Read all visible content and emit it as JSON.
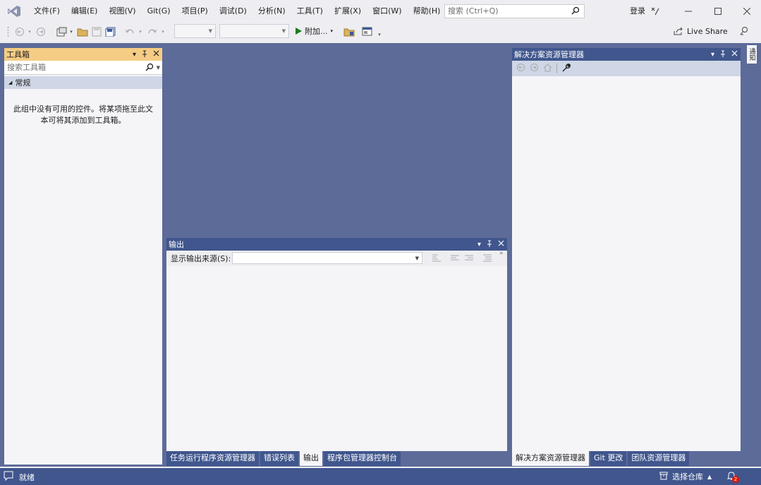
{
  "menu": [
    "文件(F)",
    "编辑(E)",
    "视图(V)",
    "Git(G)",
    "项目(P)",
    "调试(D)",
    "分析(N)",
    "工具(T)",
    "扩展(X)",
    "窗口(W)",
    "帮助(H)"
  ],
  "search": {
    "placeholder": "搜索 (Ctrl+Q)"
  },
  "signin": "登录",
  "toolbar": {
    "attach_label": "附加...",
    "live_share": "Live Share"
  },
  "toolbox": {
    "title": "工具箱",
    "search_placeholder": "搜索工具箱",
    "group": "常规",
    "empty_text": "此组中没有可用的控件。将某项拖至此文本可将其添加到工具箱。"
  },
  "output": {
    "title": "输出",
    "source_label": "显示输出来源(S):",
    "tabs": [
      "任务运行程序资源管理器",
      "错误列表",
      "输出",
      "程序包管理器控制台"
    ],
    "active_tab": 2
  },
  "solution_explorer": {
    "title": "解决方案资源管理器",
    "tabs": [
      "解决方案资源管理器",
      "Git 更改",
      "团队资源管理器"
    ],
    "active_tab": 0
  },
  "side_strip": {
    "label": "通知"
  },
  "status": {
    "ready": "就绪",
    "repo": "选择仓库",
    "notifications": "2"
  },
  "colors": {
    "workspace": "#5d6b99",
    "active_header": "#f5cc84",
    "inactive_header": "#40568d",
    "statusbar": "#40568d"
  }
}
